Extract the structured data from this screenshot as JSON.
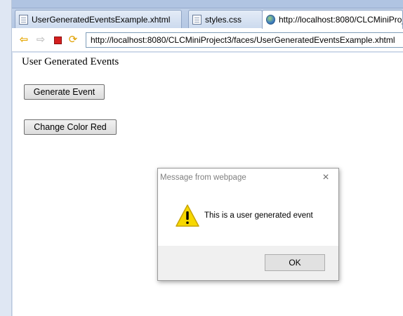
{
  "browser": {
    "tabs": [
      {
        "label": "UserGeneratedEventsExample.xhtml",
        "icon": "document-icon"
      },
      {
        "label": "styles.css",
        "icon": "document-icon"
      },
      {
        "label": "http://localhost:8080/CLCMiniProj",
        "icon": "globe-icon"
      }
    ],
    "toolbar": {
      "back": "⇦",
      "forward": "⇨",
      "refresh": "⟳",
      "url": "http://localhost:8080/CLCMiniProject3/faces/UserGeneratedEventsExample.xhtml"
    }
  },
  "page": {
    "title": "User Generated Events",
    "buttons": {
      "generate": "Generate Event",
      "change_color": "Change Color Red"
    }
  },
  "dialog": {
    "title": "Message from webpage",
    "close": "×",
    "message": "This is a user generated event",
    "ok": "OK"
  },
  "colors": {
    "tab_strip": "#b4c7e3",
    "stop_red": "#d41f1f",
    "warning_yellow": "#f7d800",
    "dialog_footer": "#f0f0f0"
  }
}
